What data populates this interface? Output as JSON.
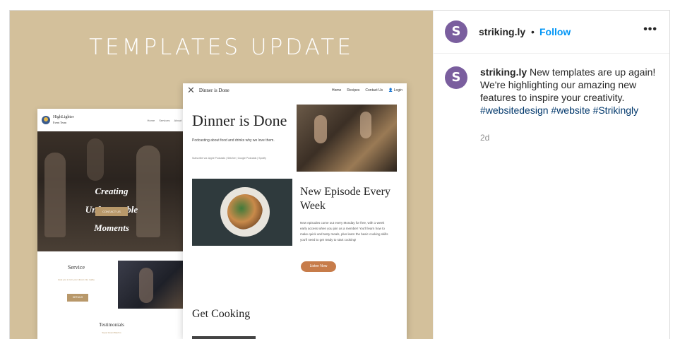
{
  "media": {
    "title": "TEMPLATES UPDATE",
    "left_mockup": {
      "brand_line1": "HighLighter",
      "brand_line2": "Event Team",
      "nav": [
        "Home",
        "Services",
        "About"
      ],
      "hero_lines": [
        "Creating",
        "Unforgettable",
        "Moments"
      ],
      "contact_button": "CONTACT US",
      "service_title": "Service",
      "service_sub": "Help you to turn your dream into reality",
      "details_button": "DETAILS",
      "testimonials_title": "Testimonials",
      "testimonials_sub": "Super Event Bash is"
    },
    "right_mockup": {
      "brand": "Dinner is Done",
      "nav": [
        "Home",
        "Recipes",
        "Contact Us",
        "Login"
      ],
      "headline": "Dinner is Done",
      "tagline": "Podcasting about food and drinks why we love them.",
      "subscribe": "Subscribe via: Apple Podcasts | Stitcher | Google Podcasts | Spotify",
      "episode_title": "New Episode Every Week",
      "episode_text": "New episodes come out every Monday for free, with 1-week early access when you join as a member! You'll learn how to make quick and tasty meals, plus learn the basic cooking skills you'll need to get ready to start cooking!",
      "listen_button": "Listen Now",
      "section_title": "Get Cooking"
    }
  },
  "header": {
    "avatar_letter": "S",
    "username": "striking.ly",
    "separator": "•",
    "follow_label": "Follow",
    "more_label": "•••"
  },
  "caption": {
    "avatar_letter": "S",
    "username": "striking.ly",
    "text": " New templates are up again! We're highlighting our amazing new features to inspire your creativity. ",
    "hashtags": [
      "#websitedesign",
      "#website",
      "#Strikingly"
    ],
    "time": "2d"
  },
  "colors": {
    "media_bg": "#d3c09b",
    "avatar": "#7a5e9e",
    "follow": "#0095f6",
    "hashtag": "#00376b"
  }
}
